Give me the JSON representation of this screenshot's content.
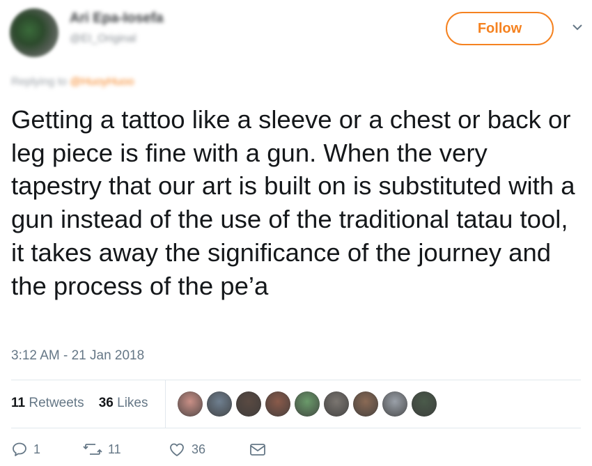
{
  "user": {
    "name": "Ari Epa-Iosefa",
    "handle": "@EI_Original"
  },
  "header": {
    "follow_label": "Follow"
  },
  "reply": {
    "prefix": "Replying to",
    "target": "@HuoyHuoo"
  },
  "tweet": {
    "text": "Getting a tattoo like a sleeve or a chest or back or leg piece is fine with a gun. When the very tapestry that our art is built on is substituted with a gun instead of the use of the traditional tatau tool, it takes away the significance of the journey and the process of the pe’a",
    "timestamp": "3:12 AM - 21 Jan 2018"
  },
  "stats": {
    "retweets_count": "11",
    "retweets_label": "Retweets",
    "likes_count": "36",
    "likes_label": "Likes"
  },
  "actions": {
    "reply_count": "1",
    "retweet_count": "11",
    "like_count": "36"
  },
  "colors": {
    "accent": "#f58220",
    "text": "#14171a",
    "muted": "#657786",
    "liker_avatars": [
      "#c98f86",
      "#6f7f8f",
      "#5a4a42",
      "#8a5a4a",
      "#6a9a6a",
      "#7a7570",
      "#8a6a55",
      "#9aa0a8",
      "#4a5a4a"
    ]
  }
}
